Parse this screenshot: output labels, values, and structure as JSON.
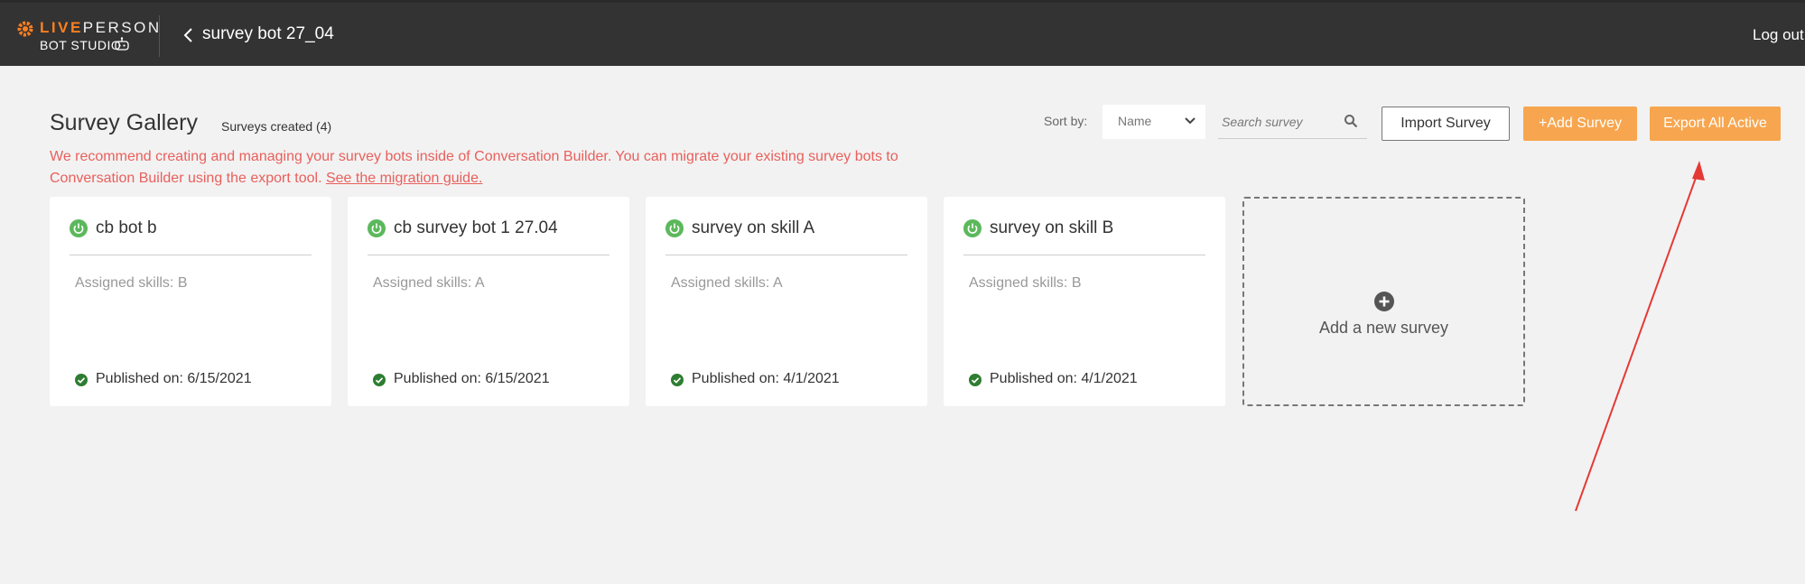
{
  "header": {
    "logo_line1_a": "LIVE",
    "logo_line1_b": "PERSON",
    "logo_line2": "BOT STUDIO",
    "bot_name": "survey bot 27_04",
    "logout": "Log out"
  },
  "gallery": {
    "title": "Survey Gallery",
    "count": "Surveys created (4)",
    "notice": "We recommend creating and managing your survey bots inside of Conversation Builder. You can migrate your existing survey bots to Conversation Builder using the export tool.",
    "notice_link": "See the migration guide."
  },
  "toolbar": {
    "sort_label": "Sort by:",
    "sort_value": "Name",
    "search_placeholder": "Search survey",
    "import_label": "Import Survey",
    "add_label": "+Add Survey",
    "export_label": "Export All Active"
  },
  "cards": [
    {
      "title": "cb bot b",
      "skills": "Assigned skills: B",
      "published": "Published on: 6/15/2021"
    },
    {
      "title": "cb survey bot 1 27.04",
      "skills": "Assigned skills: A",
      "published": "Published on: 6/15/2021"
    },
    {
      "title": "survey on skill A",
      "skills": "Assigned skills: A",
      "published": "Published on: 4/1/2021"
    },
    {
      "title": "survey on skill B",
      "skills": "Assigned skills: B",
      "published": "Published on: 4/1/2021"
    }
  ],
  "add_card": {
    "label": "Add a new survey"
  },
  "colors": {
    "brand_orange": "#ff7f1f",
    "button_orange": "#f7a64f",
    "status_green": "#5cb85c",
    "check_green": "#2e7d32",
    "notice_red": "#e8605c",
    "annotation_red": "#e53935"
  },
  "icons": [
    "liveperson-logo-icon",
    "robot-icon",
    "chevron-left-icon",
    "chevron-down-icon",
    "search-icon",
    "power-icon",
    "check-circle-icon",
    "plus-circle-icon"
  ]
}
